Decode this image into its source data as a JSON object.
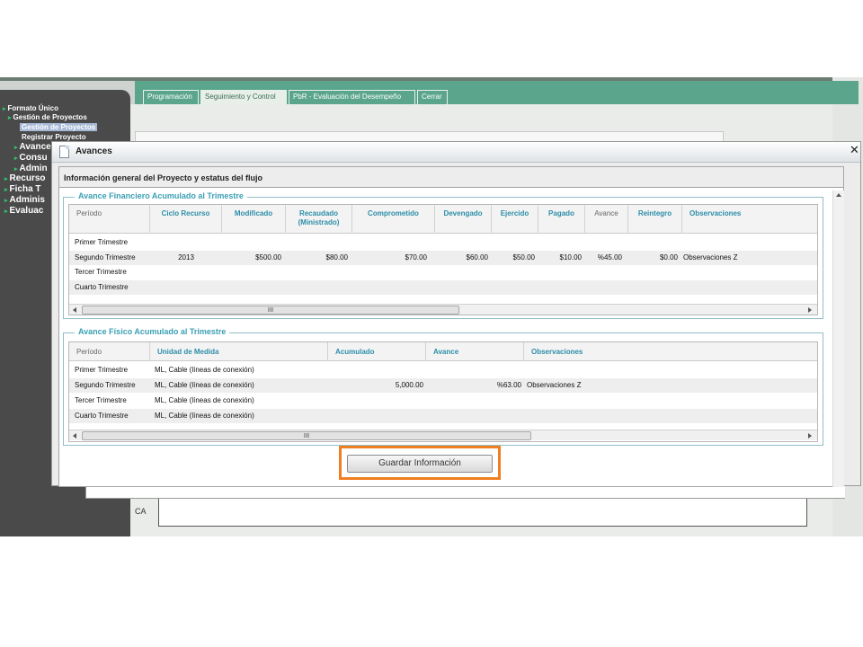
{
  "sidebar": {
    "items": [
      {
        "label": "Formato Único"
      },
      {
        "label": "Gestión de Proyectos"
      },
      {
        "label": "Gestión de Proyectos"
      },
      {
        "label": "Registrar Proyecto"
      },
      {
        "label": "Avances"
      },
      {
        "label": "Consu"
      },
      {
        "label": "Admin"
      },
      {
        "label": "Recurso"
      },
      {
        "label": "Ficha T"
      },
      {
        "label": "Adminis"
      },
      {
        "label": "Evaluac"
      }
    ]
  },
  "tabs": [
    {
      "label": "Programación"
    },
    {
      "label": "Seguimiento y Control"
    },
    {
      "label": "PbR - Evaluación del Desempeño"
    },
    {
      "label": "Cerrar"
    }
  ],
  "background": {
    "ca_label": "CA"
  },
  "modal": {
    "title": "Avances",
    "close_symbol": "✕",
    "info_title": "Información general del Proyecto y estatus del flujo",
    "financial": {
      "legend": "Avance Financiero Acumulado al Trimestre",
      "columns": [
        "Período",
        "Ciclo Recurso",
        "Modificado",
        "Recaudado (Ministrado)",
        "Comprometido",
        "Devengado",
        "Ejercido",
        "Pagado",
        "Avance",
        "Reintegro",
        "Observaciones"
      ],
      "rows": [
        [
          "Primer Trimestre",
          "",
          "",
          "",
          "",
          "",
          "",
          "",
          "",
          "",
          ""
        ],
        [
          "Segundo Trimestre",
          "2013",
          "$500.00",
          "$80.00",
          "$70.00",
          "$60.00",
          "$50.00",
          "$10.00",
          "%45.00",
          "$0.00",
          "Observaciones Z"
        ],
        [
          "Tercer Trimestre",
          "",
          "",
          "",
          "",
          "",
          "",
          "",
          "",
          "",
          ""
        ],
        [
          "Cuarto Trimestre",
          "",
          "",
          "",
          "",
          "",
          "",
          "",
          "",
          "",
          ""
        ]
      ],
      "scroll_grip": "III"
    },
    "physical": {
      "legend": "Avance Físico Acumulado al Trimestre",
      "columns": [
        "Período",
        "Unidad de Medida",
        "Acumulado",
        "Avance",
        "Observaciones"
      ],
      "rows": [
        [
          "Primer Trimestre",
          "ML, Cable (líneas de conexión)",
          "",
          "",
          ""
        ],
        [
          "Segundo Trimestre",
          "ML, Cable (líneas de conexión)",
          "5,000.00",
          "%63.00",
          "Observaciones Z"
        ],
        [
          "Tercer Trimestre",
          "ML, Cable (líneas de conexión)",
          "",
          "",
          ""
        ],
        [
          "Cuarto Trimestre",
          "ML, Cable (líneas de conexión)",
          "",
          "",
          ""
        ]
      ],
      "scroll_grip": "III"
    },
    "save_label": "Guardar Información"
  },
  "colors": {
    "highlight": "#f07f22",
    "accent": "#2d8ea8",
    "tabbar": "#5aa58c"
  }
}
